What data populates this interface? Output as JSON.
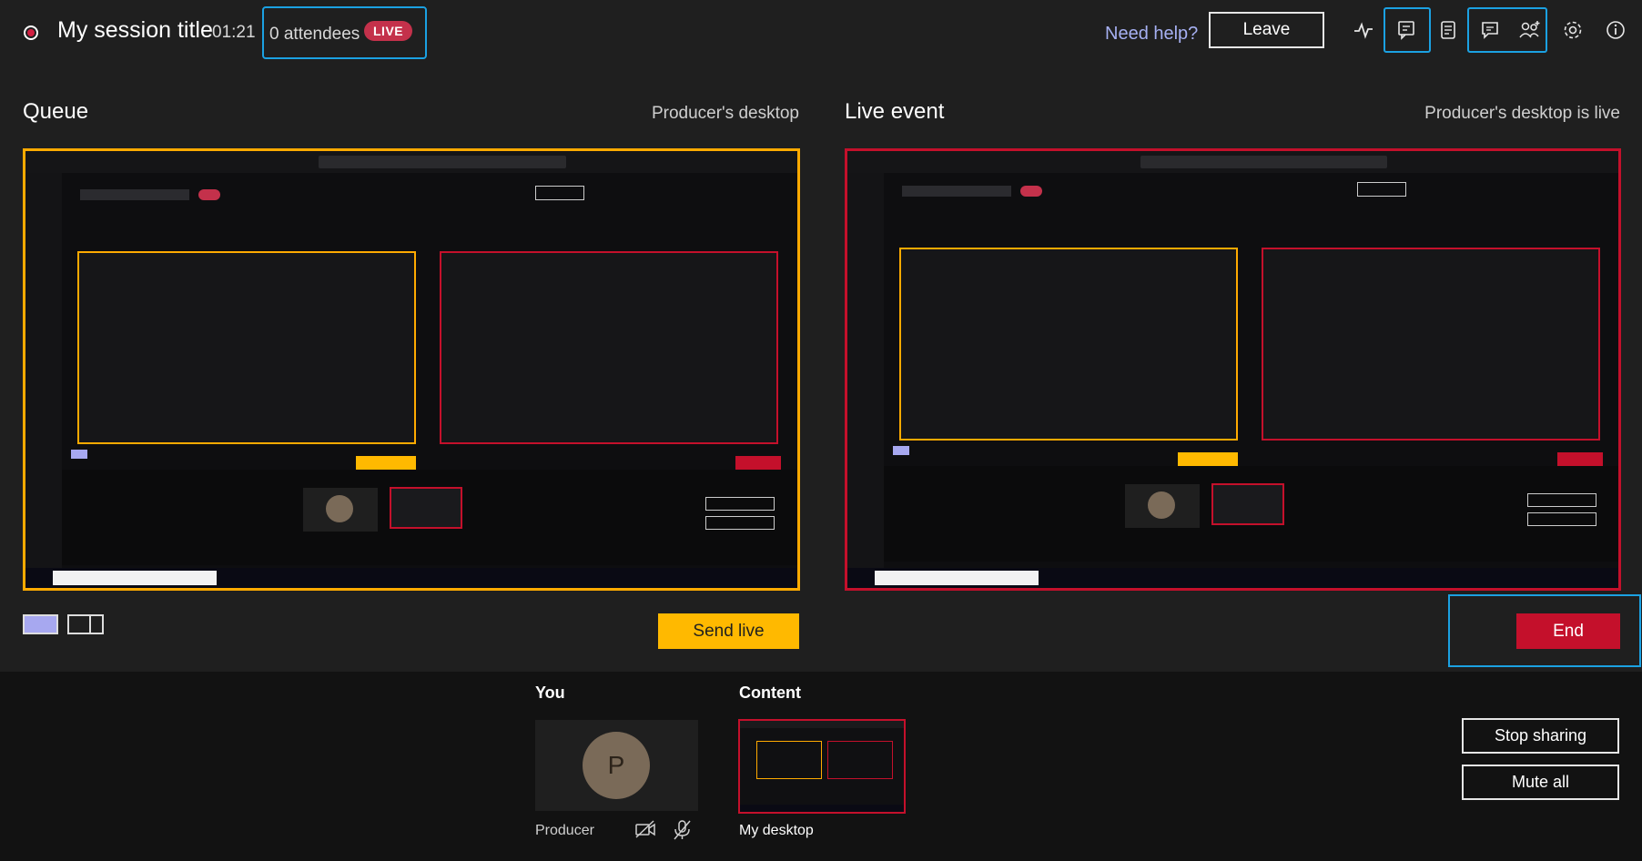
{
  "header": {
    "title": "My session title",
    "timer": "01:21",
    "attendees": "0 attendees",
    "live_badge": "LIVE",
    "need_help": "Need help?",
    "leave": "Leave"
  },
  "toolbar_icons": [
    "health-icon",
    "q-and-a-icon",
    "meeting-notes-icon",
    "chat-icon",
    "participants-icon",
    "settings-icon",
    "info-icon"
  ],
  "queue": {
    "title": "Queue",
    "source": "Producer's desktop",
    "send_live": "Send live"
  },
  "live_event": {
    "title": "Live event",
    "status": "Producer's desktop is live",
    "end": "End"
  },
  "bottom": {
    "you_label": "You",
    "avatar_initial": "P",
    "producer_name": "Producer",
    "content_label": "Content",
    "content_name": "My desktop",
    "stop_sharing": "Stop sharing",
    "mute_all": "Mute all"
  },
  "colors": {
    "background": "#1f1f1f",
    "queue_border": "#ffaa00",
    "live_border": "#c4102b",
    "send_live": "#ffb900",
    "end": "#c4102b",
    "highlight": "#1ba1e2",
    "live_badge": "#c4314b"
  }
}
